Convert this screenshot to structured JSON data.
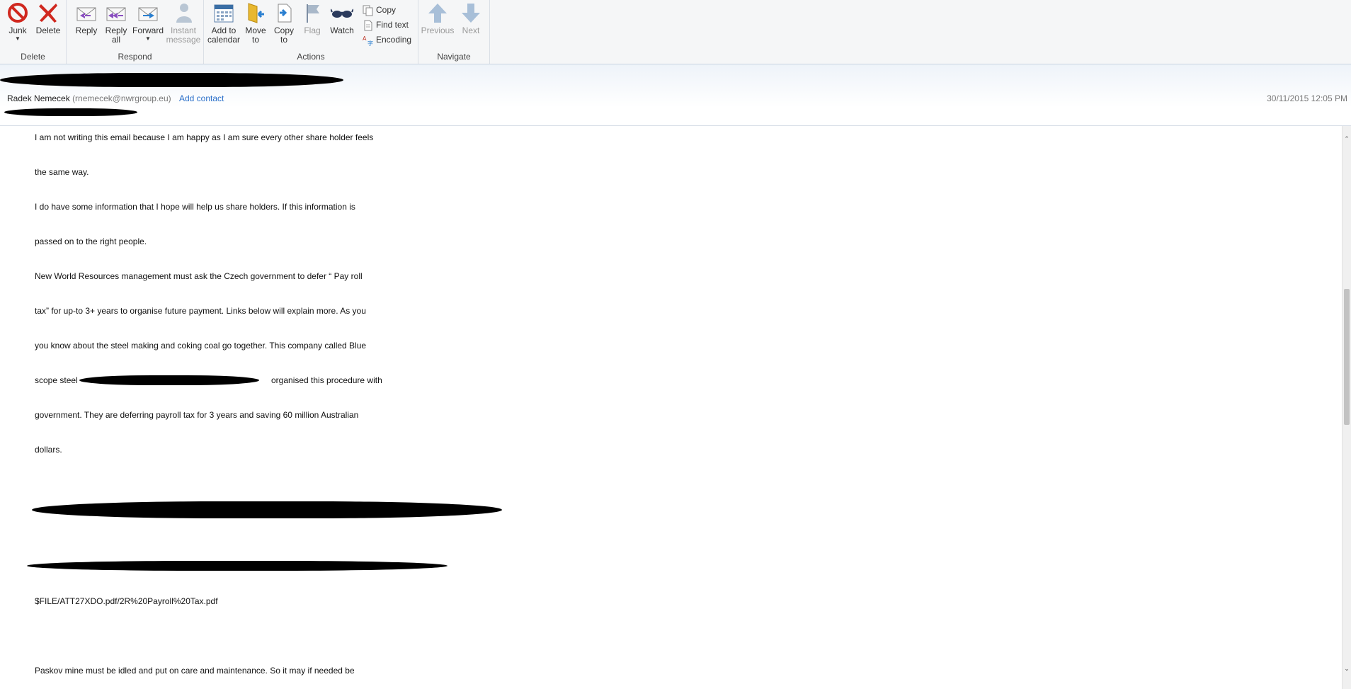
{
  "ribbon": {
    "groups": {
      "delete": {
        "label": "Delete",
        "junk": "Junk",
        "delete": "Delete"
      },
      "respond": {
        "label": "Respond",
        "reply": "Reply",
        "reply_all": "Reply\nall",
        "forward": "Forward",
        "instant_message": "Instant\nmessage"
      },
      "actions": {
        "label": "Actions",
        "add_to_calendar": "Add to\ncalendar",
        "move_to": "Move\nto",
        "copy_to": "Copy\nto",
        "flag": "Flag",
        "watch": "Watch",
        "copy": "Copy",
        "find_text": "Find text",
        "encoding": "Encoding"
      },
      "navigate": {
        "label": "Navigate",
        "previous": "Previous",
        "next": "Next"
      }
    },
    "icons": {
      "junk": "no-entry-icon",
      "delete": "x-icon",
      "reply": "reply-envelope-icon",
      "reply_all": "reply-all-envelope-icon",
      "forward": "forward-envelope-icon",
      "instant_message": "person-icon",
      "calendar": "calendar-icon",
      "move": "folder-icon",
      "copy_to": "document-icon",
      "flag": "flag-icon",
      "watch": "glasses-icon",
      "previous": "up-arrow-icon",
      "next": "down-arrow-icon"
    }
  },
  "header": {
    "sender_name": "Radek Nemecek",
    "sender_email": "(rnemecek@nwrgroup.eu)",
    "add_contact": "Add contact",
    "datetime": "30/11/2015 12:05 PM"
  },
  "body": {
    "lines": [
      "I am not writing this email because I am happy as I am sure every other share holder feels",
      "the same way.",
      "I do have some information that I hope will help us share holders. If this information is",
      "passed on to the right people.",
      "New World Resources management must ask the Czech government to defer “ Pay roll",
      "tax” for up-to 3+ years to organise future payment. Links below will explain more. As you",
      "you know about the steel making and coking coal go together. This company called Blue",
      "scope steel",
      "organised this procedure with",
      "government. They are deferring payroll tax for 3 years and saving 60 million Australian",
      "dollars.",
      "$FILE/ATT27XDO.pdf/2R%20Payroll%20Tax.pdf",
      "Paskov mine must be idled and put on care and maintenance. So it may if needed be"
    ]
  },
  "colors": {
    "accent_link": "#2a6fc9",
    "ribbon_bg": "#f5f6f7",
    "redaction": "#000000"
  }
}
